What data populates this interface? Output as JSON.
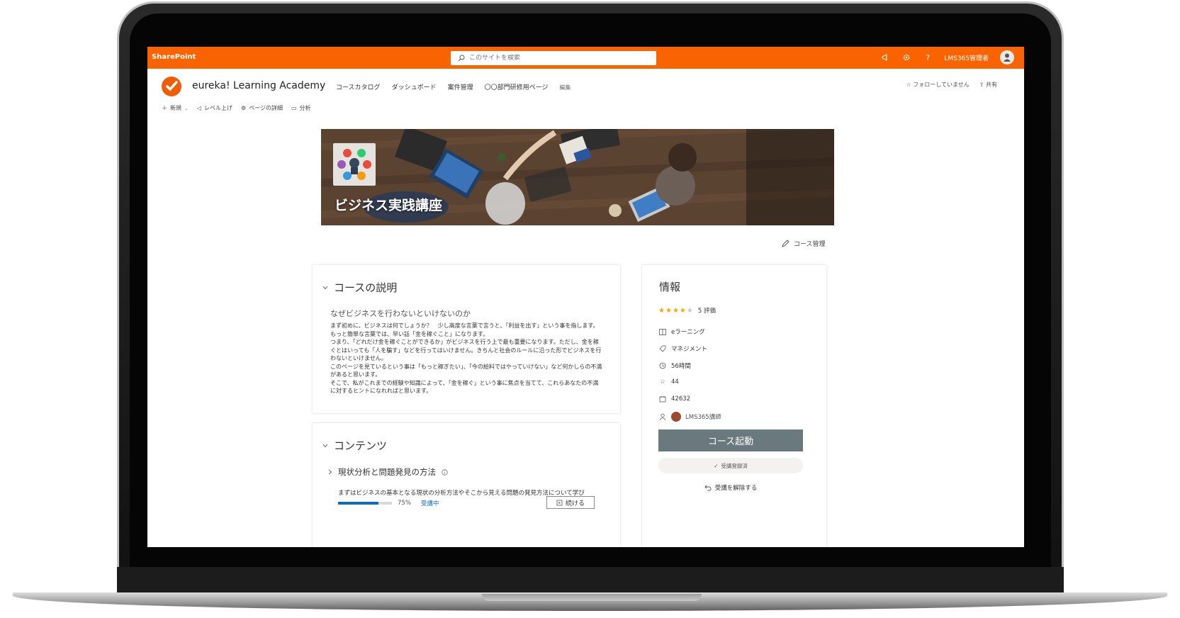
{
  "suitebar": {
    "brand": "SharePoint",
    "search_placeholder": "このサイトを検索",
    "user_name": "LMS365管理者"
  },
  "site": {
    "title": "eureka! Learning Academy",
    "nav": [
      "コースカタログ",
      "ダッシュボード",
      "案件管理",
      "〇〇部門研修用ページ"
    ],
    "edit_label": "編集",
    "follow_label": "フォローしていません",
    "share_label": "共有"
  },
  "commandbar": {
    "new_label": "新規",
    "promote_label": "レベル上げ",
    "page_details_label": "ページの詳細",
    "analytics_label": "分析"
  },
  "hero": {
    "title": "ビジネス実践講座"
  },
  "course_mgmt_label": "コース管理",
  "description": {
    "heading": "コースの説明",
    "subheading": "なぜビジネスを行わないといけないのか",
    "body": [
      "まず初めに、ビジネスは何でしょうか？　少し高度な言葉で言うと、「利益を出す」という事を指します。もっと簡単な言葉では、早い話「金を稼ぐこと」になります。",
      "つまり、「どれだけ金を稼ぐことができるか」がビジネスを行う上で最も重要になります。ただし、金を稼ぐとはいっても「人を騙す」などを行ってはいけません。きちんと社会のルールに沿った形でビジネスを行わないといけません。",
      "このページを見ているという事は「もっと稼ぎたい」、「今の給料ではやっていけない」など何かしらの不満があると思います。",
      "そこで、私がこれまでの経験や知識によって、「金を稼ぐ」という事に焦点を当てて、これらあなたの不満に対するヒントになれればと思います。"
    ]
  },
  "contents": {
    "heading": "コンテンツ",
    "item_title": "現状分析と問題発見の方法",
    "item_desc": "まずはビジネスの基本となる現状の分析方法やそこから見える問題の発見方法について学び",
    "progress": 0.75,
    "progress_label": "75%",
    "status": "受講中",
    "continue_label": "続ける"
  },
  "info": {
    "heading": "情報",
    "rating": 4,
    "rating_max": 5,
    "rating_count": "5 評価",
    "type": "eラーニング",
    "category": "マネジメント",
    "duration": "56時間",
    "points": "44",
    "id": "42632",
    "instructor": "LMS365講師",
    "launch_label": "コース起動",
    "enrolled_label": "受講登録済",
    "unenroll_label": "受講を解除する"
  },
  "colors": {
    "suitebar": "#fa6400",
    "launch_button": "#69797e",
    "progress": "#0f6cbd"
  }
}
